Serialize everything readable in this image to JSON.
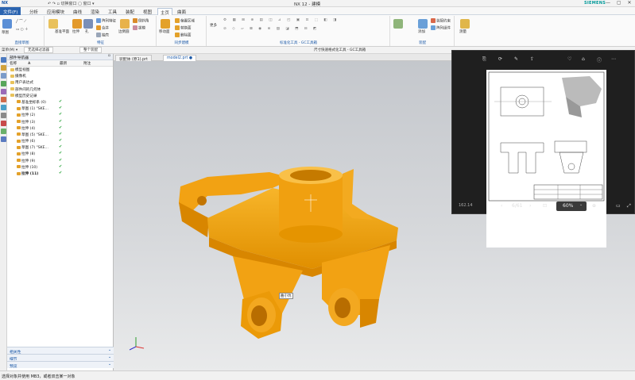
{
  "app": {
    "logo": "NX",
    "quick_access": "↶ ↷ ▫ 切换窗口 ▢ 窗口 ▾",
    "title": "NX 12 - 建模",
    "brand": "SIEMENS",
    "window_controls": "— ▢ ✕"
  },
  "tabs": [
    "文件(F)",
    "分析",
    "应用模块",
    "曲线",
    "渲染",
    "工具",
    "装配",
    "视图",
    "主页",
    "曲面"
  ],
  "ribbon": {
    "g1": {
      "label": "直接草图",
      "btn": "草图"
    },
    "g2": {
      "label": "特征",
      "items": [
        "基准平面",
        "拉伸",
        "孔",
        "阵列特征",
        "合并",
        "抽壳",
        "边倒圆",
        "倒斜角",
        "拔模"
      ]
    },
    "g3": {
      "label": "同步建模",
      "items": [
        "移动面",
        "偏置区域",
        "替换面",
        "删除面"
      ]
    },
    "g4": {
      "label": "标准化工具 - GC工具箱",
      "items": [
        "更多"
      ]
    },
    "g5": {
      "label": "装配",
      "items": [
        "添加",
        "装配约束",
        "阵列组件"
      ]
    },
    "g6": {
      "label": "",
      "items": [
        "测量"
      ]
    }
  },
  "cmdbar": [
    "菜单(M) ▾",
    "无选择过滤器",
    "整个装配",
    "尺寸快速格式化工具 - GC工具箱"
  ],
  "doctabs": [
    "装配体 (原1).prt",
    "model2.prt ●"
  ],
  "nav": {
    "title": "部件导航器",
    "col_name": "名称",
    "col_recent": "最新",
    "col_note": "附注",
    "rows": [
      {
        "indent": 1,
        "text": "模型视图",
        "ck": ""
      },
      {
        "indent": 1,
        "text": "摄像机",
        "ck": ""
      },
      {
        "indent": 1,
        "text": "用户表达式",
        "ck": ""
      },
      {
        "indent": 1,
        "text": "部件间的几何体",
        "ck": ""
      },
      {
        "indent": 1,
        "text": "模型历史记录",
        "ck": ""
      },
      {
        "indent": 2,
        "text": "基准坐标系 (0)",
        "ck": "✔"
      },
      {
        "indent": 2,
        "text": "草图 (1) \"SKE...",
        "ck": "✔"
      },
      {
        "indent": 2,
        "text": "拉伸 (2)",
        "ck": "✔"
      },
      {
        "indent": 2,
        "text": "拉伸 (3)",
        "ck": "✔"
      },
      {
        "indent": 2,
        "text": "拉伸 (4)",
        "ck": "✔"
      },
      {
        "indent": 2,
        "text": "草图 (5) \"SKE...",
        "ck": "✔"
      },
      {
        "indent": 2,
        "text": "拉伸 (6)",
        "ck": "✔"
      },
      {
        "indent": 2,
        "text": "草图 (7) \"SKE...",
        "ck": "✔"
      },
      {
        "indent": 2,
        "text": "拉伸 (8)",
        "ck": "✔"
      },
      {
        "indent": 2,
        "text": "拉伸 (9)",
        "ck": "✔"
      },
      {
        "indent": 2,
        "text": "拉伸 (10)",
        "ck": "✔"
      },
      {
        "indent": 2,
        "text": "拉伸 (11)",
        "ck": "✔"
      }
    ],
    "footers": [
      "相关性",
      "细节",
      "预览"
    ]
  },
  "viewport": {
    "tag": "曲小坑"
  },
  "photo": {
    "resolution": "162.14",
    "page": "6/61",
    "zoom": "60%"
  },
  "status": "选择对象并使用 MB3，或者双击某一对象",
  "colors": {
    "part": "#f2a213",
    "accent": "#1d5aa8",
    "file_tab": "#2b64b0"
  }
}
